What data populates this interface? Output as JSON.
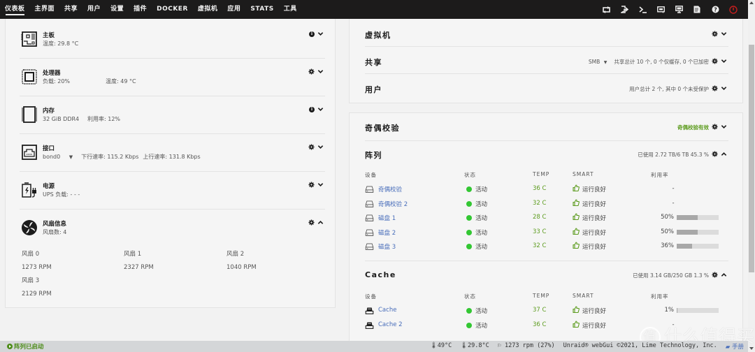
{
  "nav": {
    "items": [
      {
        "label": "仪表板",
        "active": true
      },
      {
        "label": "主界面"
      },
      {
        "label": "共享"
      },
      {
        "label": "用户"
      },
      {
        "label": "设置"
      },
      {
        "label": "插件"
      },
      {
        "label": "DOCKER"
      },
      {
        "label": "虚拟机"
      },
      {
        "label": "应用"
      },
      {
        "label": "STATS"
      },
      {
        "label": "工具"
      }
    ],
    "icons": [
      "refresh-icon",
      "logout-icon",
      "terminal-icon",
      "feedback-icon",
      "info-display-icon",
      "log-icon",
      "help-icon",
      "power-icon"
    ]
  },
  "left": {
    "motherboard": {
      "title": "主板",
      "temp": "温度: 29.8 °C"
    },
    "cpu": {
      "title": "处理器",
      "load": "负载: 20%",
      "temp": "温度: 49 °C"
    },
    "memory": {
      "title": "内存",
      "size": "32 GiB DDR4",
      "usage": "利用率: 12%"
    },
    "interface": {
      "title": "接口",
      "iface": "bond0",
      "down": "下行速率: 115.2 Kbps",
      "up": "上行速率: 131.8 Kbps"
    },
    "power": {
      "title": "电源",
      "ups": "UPS 负载: - - -"
    },
    "fans": {
      "title": "风扇信息",
      "count": "风扇数: 4",
      "items": [
        {
          "name": "风扇 0",
          "rpm": "1273 RPM"
        },
        {
          "name": "风扇 1",
          "rpm": "2327 RPM"
        },
        {
          "name": "风扇 2",
          "rpm": "1040 RPM"
        },
        {
          "name": "风扇 3",
          "rpm": "2129 RPM"
        }
      ]
    }
  },
  "right_top": {
    "vm": {
      "title": "虚拟机"
    },
    "shares": {
      "title": "共享",
      "protocol": "SMB",
      "info": "共享总计 10 个, 0 个仅缓存, 0 个已加密"
    },
    "users": {
      "title": "用户",
      "info": "用户总计 2 个, 其中 0 个未受保护"
    }
  },
  "parity": {
    "title": "奇偶校验",
    "status": "奇偶校验有效",
    "status_color": "#5d9c1f"
  },
  "array": {
    "title": "阵列",
    "usage": "已使用 2.72 TB/6 TB 45.3 %",
    "headers": {
      "device": "设备",
      "status": "状态",
      "temp": "TEMP",
      "smart": "SMART",
      "util": "利用率"
    },
    "rows": [
      {
        "name": "奇偶校验",
        "status": "活动",
        "temp": "36 C",
        "smart": "运行良好",
        "util": "-",
        "util_pct": null
      },
      {
        "name": "奇偶校验 2",
        "status": "活动",
        "temp": "32 C",
        "smart": "运行良好",
        "util": "-",
        "util_pct": null
      },
      {
        "name": "磁盘 1",
        "status": "活动",
        "temp": "28 C",
        "smart": "运行良好",
        "util": "50%",
        "util_pct": 50
      },
      {
        "name": "磁盘 2",
        "status": "活动",
        "temp": "33 C",
        "smart": "运行良好",
        "util": "50%",
        "util_pct": 50
      },
      {
        "name": "磁盘 3",
        "status": "活动",
        "temp": "32 C",
        "smart": "运行良好",
        "util": "36%",
        "util_pct": 36
      }
    ]
  },
  "cache": {
    "title": "Cache",
    "usage": "已使用 3.14 GB/250 GB 1.3 %",
    "headers": {
      "device": "设备",
      "status": "状态",
      "temp": "TEMP",
      "smart": "SMART",
      "util": "利用率"
    },
    "rows": [
      {
        "name": "Cache",
        "status": "活动",
        "temp": "37 C",
        "smart": "运行良好",
        "util": "1%",
        "util_pct": 1
      },
      {
        "name": "Cache 2",
        "status": "活动",
        "temp": "36 C",
        "smart": "运行良好",
        "util": "-",
        "util_pct": null
      }
    ]
  },
  "footer": {
    "array_status": "阵列已启动",
    "cpu_temp": "49°C",
    "mb_temp": "29.8°C",
    "fan": "1273 rpm (27%)",
    "copyright": "Unraid® webGui ©2021, Lime Technology, Inc.",
    "manual": "手册"
  },
  "watermark": {
    "mark": "值",
    "text": "什么值得买"
  },
  "colors": {
    "accent_green": "#5d9c1f",
    "status_dot": "#33c733",
    "link": "#486dba",
    "power": "#c41e1e"
  }
}
